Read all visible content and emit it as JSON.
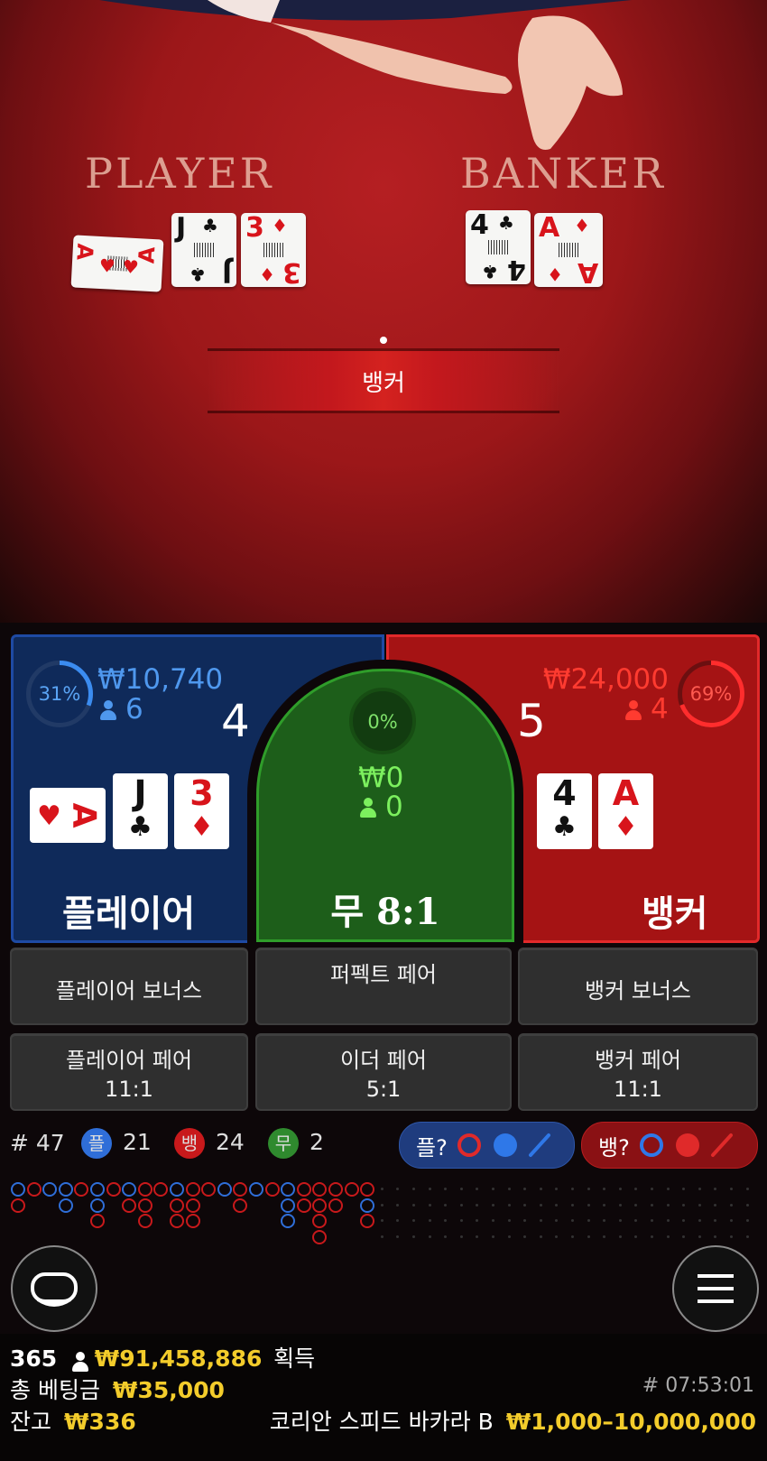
{
  "table": {
    "player_title": "PLAYER",
    "banker_title": "BANKER",
    "result_label": "뱅커",
    "player_cards": [
      {
        "rank": "A",
        "suit": "♥",
        "color": "red"
      },
      {
        "rank": "J",
        "suit": "♣",
        "color": "black"
      },
      {
        "rank": "3",
        "suit": "♦",
        "color": "red"
      }
    ],
    "banker_cards": [
      {
        "rank": "4",
        "suit": "♣",
        "color": "black"
      },
      {
        "rank": "A",
        "suit": "♦",
        "color": "red"
      }
    ]
  },
  "player": {
    "percent": "31%",
    "amount": "₩10,740",
    "bettors": "6",
    "score": "4",
    "label": "플레이어",
    "cards": [
      {
        "rank": "A",
        "suit": "♥"
      },
      {
        "rank": "J",
        "suit": "♣"
      },
      {
        "rank": "3",
        "suit": "♦"
      }
    ]
  },
  "tie": {
    "percent": "0%",
    "amount": "₩0",
    "bettors": "0",
    "label": "무 8:1"
  },
  "banker": {
    "percent": "69%",
    "amount": "₩24,000",
    "bettors": "4",
    "score": "5",
    "label": "뱅커",
    "cards": [
      {
        "rank": "4",
        "suit": "♣"
      },
      {
        "rank": "A",
        "suit": "♦"
      }
    ]
  },
  "side_bets": {
    "player_bonus": "플레이어 보너스",
    "perfect_pair": "퍼펙트 페어",
    "banker_bonus": "뱅커 보너스",
    "player_pair": "플레이어 페어",
    "player_pair_odds": "11:1",
    "either_pair": "이더 페어",
    "either_pair_odds": "5:1",
    "banker_pair": "뱅커 페어",
    "banker_pair_odds": "11:1"
  },
  "stats": {
    "round": "# 47",
    "player_badge": "플",
    "player_count": "21",
    "banker_badge": "뱅",
    "banker_count": "24",
    "tie_badge": "무",
    "tie_count": "2",
    "player_ask": "플?",
    "banker_ask": "뱅?"
  },
  "footer": {
    "players": "365",
    "winnings": "₩91,458,886",
    "winnings_label": "획득",
    "total_bet_label": "총 베팅금",
    "total_bet": "₩35,000",
    "round_id": "# 07:53:01",
    "balance_label": "잔고",
    "balance": "₩336",
    "table_name": "코리안 스피드 바카라 B",
    "limits": "₩1,000–10,000,000"
  },
  "colors": {
    "player": "#1e4aa3",
    "banker": "#d8141b",
    "tie": "#2f9d2a",
    "gold": "#f3cc2b"
  }
}
